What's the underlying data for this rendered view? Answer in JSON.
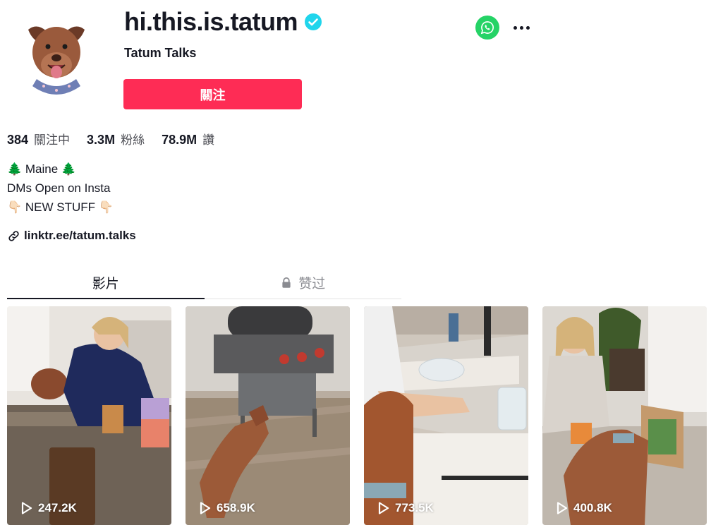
{
  "profile": {
    "username": "hi.this.is.tatum",
    "nickname": "Tatum Talks",
    "follow_label": "關注",
    "verified": true
  },
  "stats": [
    {
      "value": "384",
      "label": "關注中"
    },
    {
      "value": "3.3M",
      "label": "粉絲"
    },
    {
      "value": "78.9M",
      "label": "讚"
    }
  ],
  "bio": {
    "line1": "🌲 Maine 🌲",
    "line2": "DMs Open on Insta",
    "line3": "👇🏻 NEW STUFF 👇🏻"
  },
  "link": "linktr.ee/tatum.talks",
  "tabs": {
    "videos": "影片",
    "liked": "赞过"
  },
  "videos": [
    {
      "views": "247.2K"
    },
    {
      "views": "658.9K"
    },
    {
      "views": "773.5K"
    },
    {
      "views": "400.8K"
    }
  ],
  "colors": {
    "accent": "#fe2c55",
    "verified": "#20d5ec",
    "whatsapp": "#25d366",
    "text": "#161823"
  },
  "icons": [
    "verified-badge-icon",
    "whatsapp-icon",
    "more-options-icon",
    "link-icon",
    "lock-icon",
    "play-icon"
  ]
}
